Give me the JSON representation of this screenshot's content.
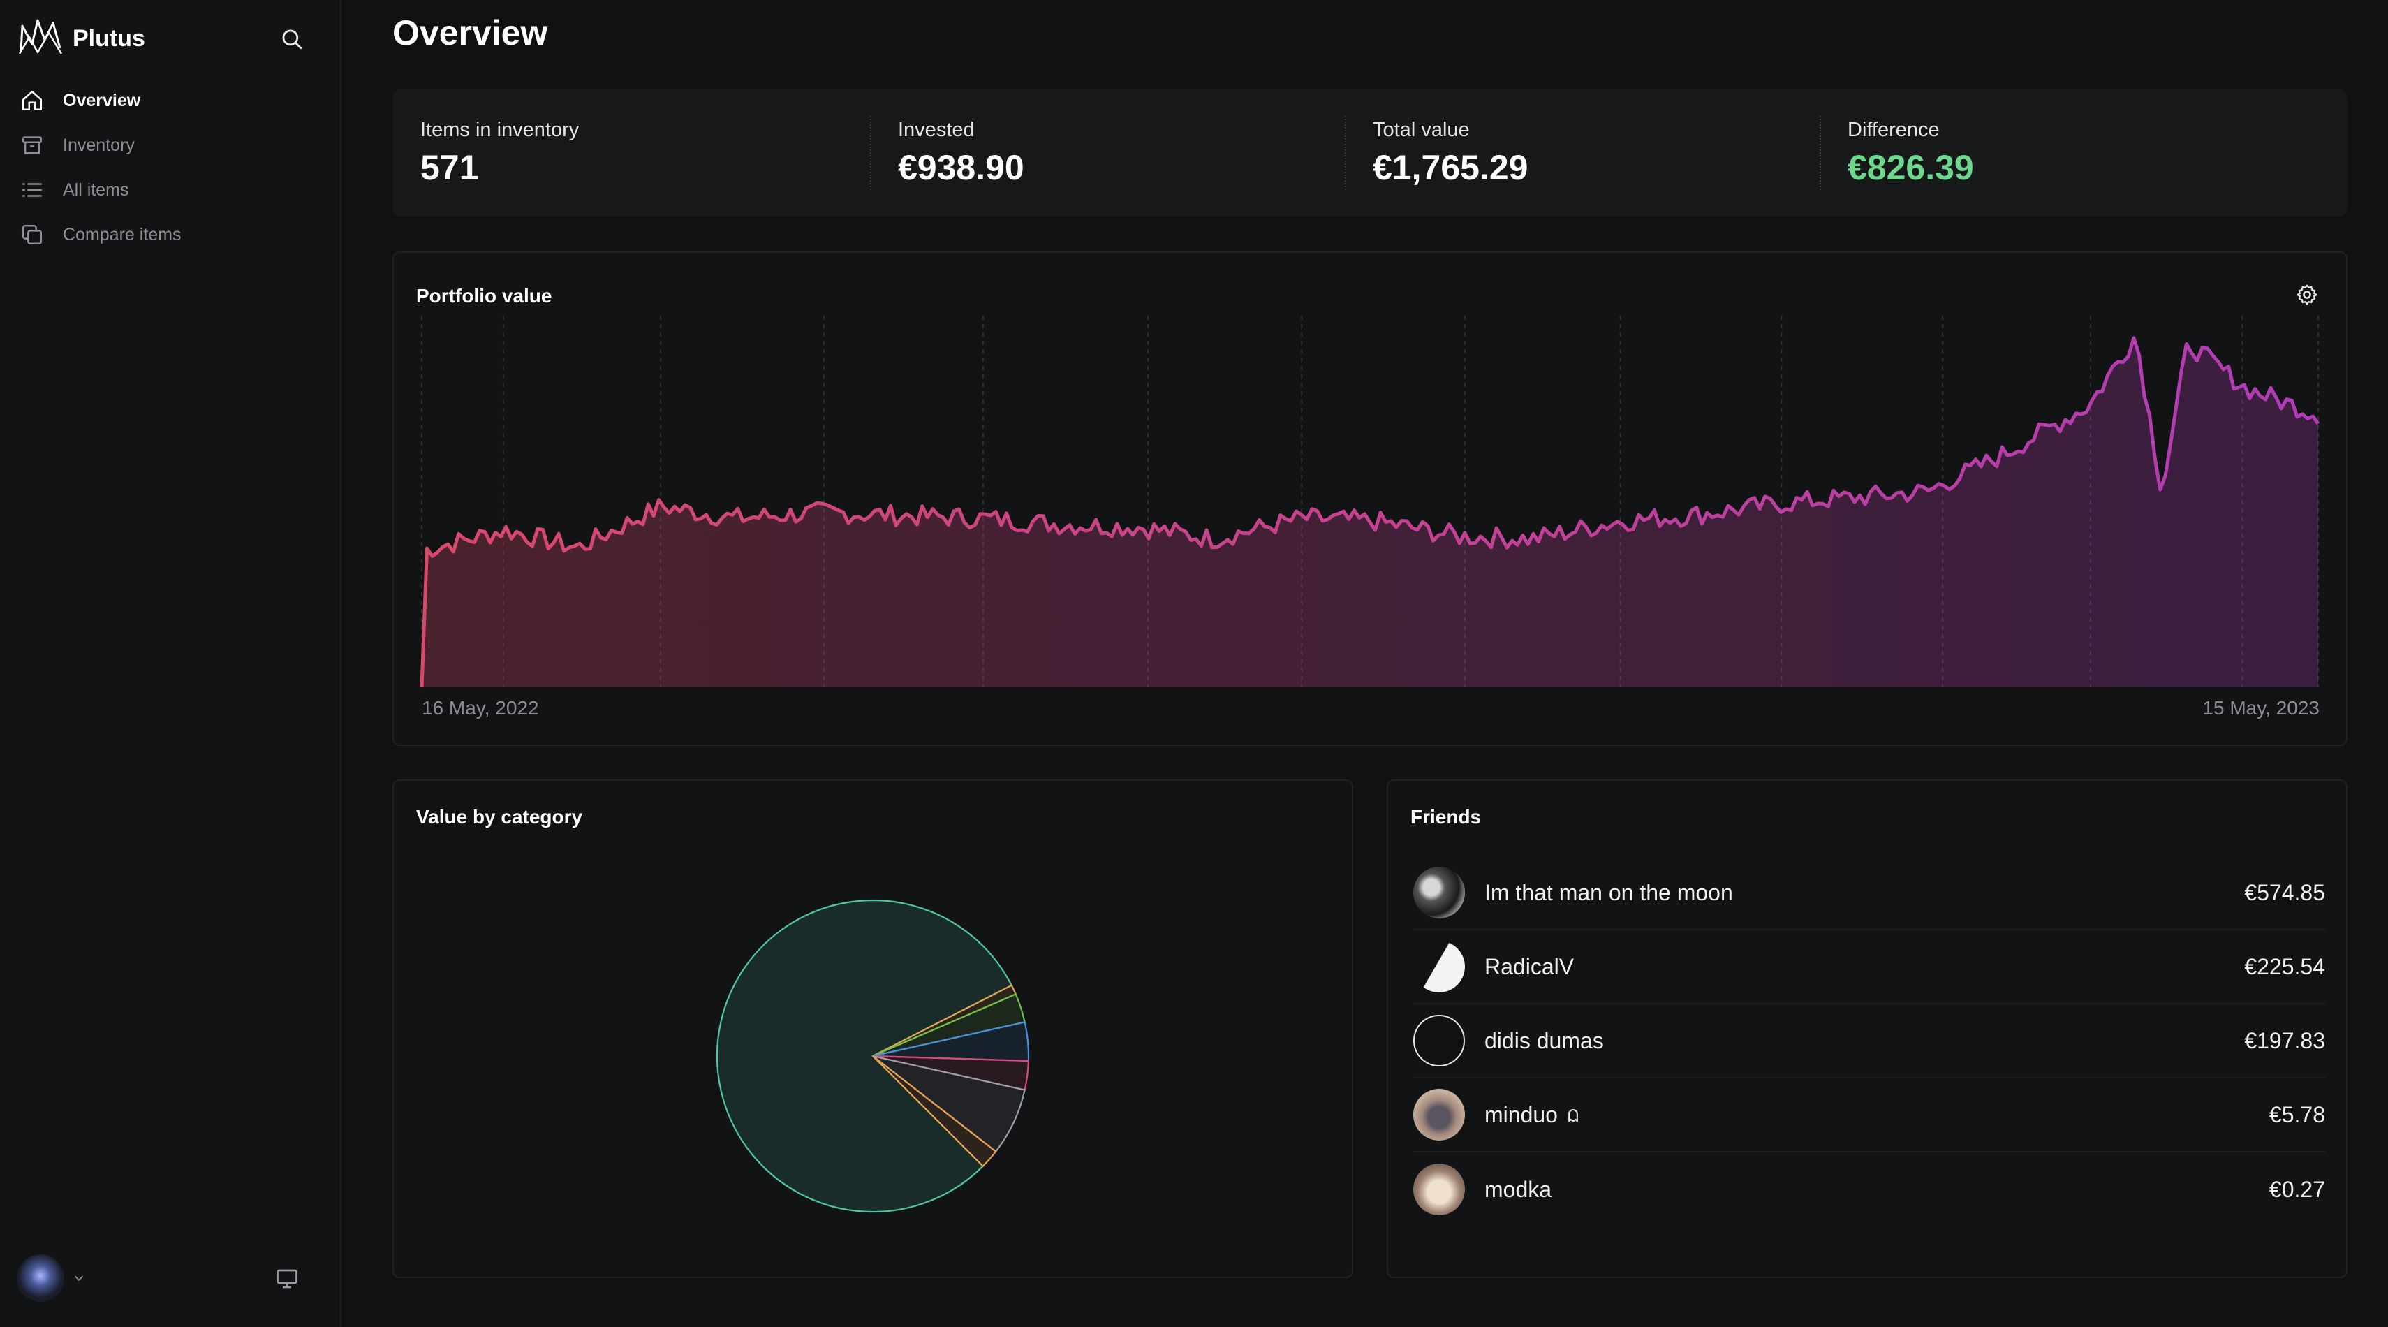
{
  "app": {
    "name": "Plutus"
  },
  "sidebar": {
    "items": [
      {
        "label": "Overview",
        "icon": "home-icon",
        "active": true
      },
      {
        "label": "Inventory",
        "icon": "archive-icon",
        "active": false
      },
      {
        "label": "All items",
        "icon": "list-icon",
        "active": false
      },
      {
        "label": "Compare items",
        "icon": "copy-icon",
        "active": false
      }
    ]
  },
  "page": {
    "title": "Overview"
  },
  "stats": [
    {
      "label": "Items in inventory",
      "value": "571"
    },
    {
      "label": "Invested",
      "value": "€938.90"
    },
    {
      "label": "Total value",
      "value": "€1,765.29"
    },
    {
      "label": "Difference",
      "value": "€826.39"
    }
  ],
  "portfolio": {
    "title": "Portfolio value",
    "start_date": "16 May, 2022",
    "end_date": "15 May, 2023"
  },
  "category": {
    "title": "Value by category"
  },
  "friends": {
    "title": "Friends",
    "list": [
      {
        "name": "Im that man on the moon",
        "value": "€574.85"
      },
      {
        "name": "RadicalV",
        "value": "€225.54"
      },
      {
        "name": "didis dumas",
        "value": "€197.83"
      },
      {
        "name": "minduo",
        "value": "€5.78",
        "badge_icon": "ghost-icon"
      },
      {
        "name": "modka",
        "value": "€0.27"
      }
    ]
  },
  "chart_data": [
    {
      "type": "area",
      "title": "Portfolio value",
      "x_range": [
        "16 May, 2022",
        "15 May, 2023"
      ],
      "x": [
        "2022-05-16",
        "2022-06-01",
        "2022-06-15",
        "2022-07-01",
        "2022-07-15",
        "2022-08-01",
        "2022-08-15",
        "2022-09-01",
        "2022-09-15",
        "2022-10-01",
        "2022-10-15",
        "2022-11-01",
        "2022-11-15",
        "2022-12-01",
        "2022-12-15",
        "2023-01-01",
        "2023-01-15",
        "2023-02-01",
        "2023-02-15",
        "2023-03-01",
        "2023-03-15",
        "2023-04-01",
        "2023-04-10",
        "2023-04-15",
        "2023-04-20",
        "2023-05-01",
        "2023-05-15"
      ],
      "values": [
        1010,
        1080,
        1020,
        1160,
        1120,
        1140,
        1130,
        1120,
        1100,
        1090,
        1050,
        1120,
        1110,
        1060,
        1050,
        1110,
        1130,
        1170,
        1190,
        1210,
        1330,
        1500,
        1740,
        1210,
        1710,
        1560,
        1470
      ],
      "y_unit": "€",
      "colors": {
        "start": "#d9496b",
        "end": "#b03cb6"
      },
      "grid": "vertical dashed"
    },
    {
      "type": "pie",
      "title": "Value by category",
      "slices": [
        {
          "value": 80.0,
          "color": "#4fc7a0"
        },
        {
          "value": 1.0,
          "color": "#e2a64a"
        },
        {
          "value": 3.0,
          "color": "#6cc24a"
        },
        {
          "value": 4.0,
          "color": "#4a90e2"
        },
        {
          "value": 3.0,
          "color": "#d94a7a"
        },
        {
          "value": 7.0,
          "color": "#9aa0a6"
        },
        {
          "value": 2.0,
          "color": "#e8a050"
        }
      ]
    }
  ]
}
